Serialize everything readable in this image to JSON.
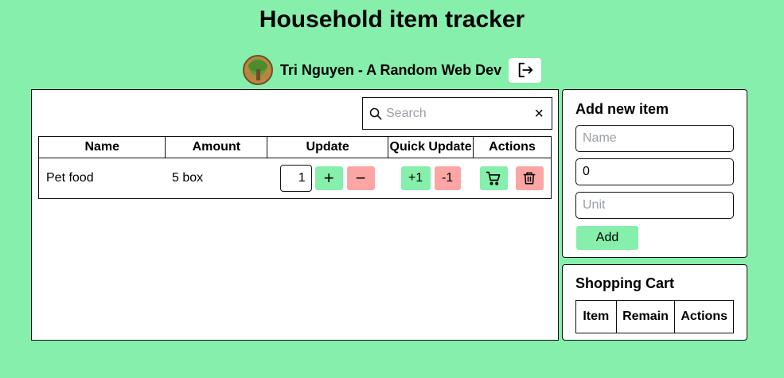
{
  "app": {
    "title": "Household item tracker"
  },
  "user": {
    "name": "Tri Nguyen - A Random Web Dev"
  },
  "search": {
    "placeholder": "Search",
    "clear_label": "×"
  },
  "items_table": {
    "headers": [
      "Name",
      "Amount",
      "Update",
      "Quick Update",
      "Actions"
    ],
    "rows": [
      {
        "name": "Pet food",
        "amount": "5 box",
        "update_value": "1",
        "plus_label": "+",
        "minus_label": "−",
        "quick_plus_label": "+1",
        "quick_minus_label": "-1"
      }
    ]
  },
  "add_item": {
    "title": "Add new item",
    "name_placeholder": "Name",
    "amount_value": "0",
    "unit_placeholder": "Unit",
    "add_label": "Add"
  },
  "shopping_cart": {
    "title": "Shopping Cart",
    "headers": [
      "Item",
      "Remain",
      "Actions"
    ]
  },
  "colors": {
    "background": "#86efac",
    "button_green": "#86efac",
    "button_red": "#fca5a5"
  },
  "icons": {
    "logout": "logout-icon",
    "search": "search-icon",
    "cart": "cart-icon",
    "trash": "trash-icon"
  }
}
